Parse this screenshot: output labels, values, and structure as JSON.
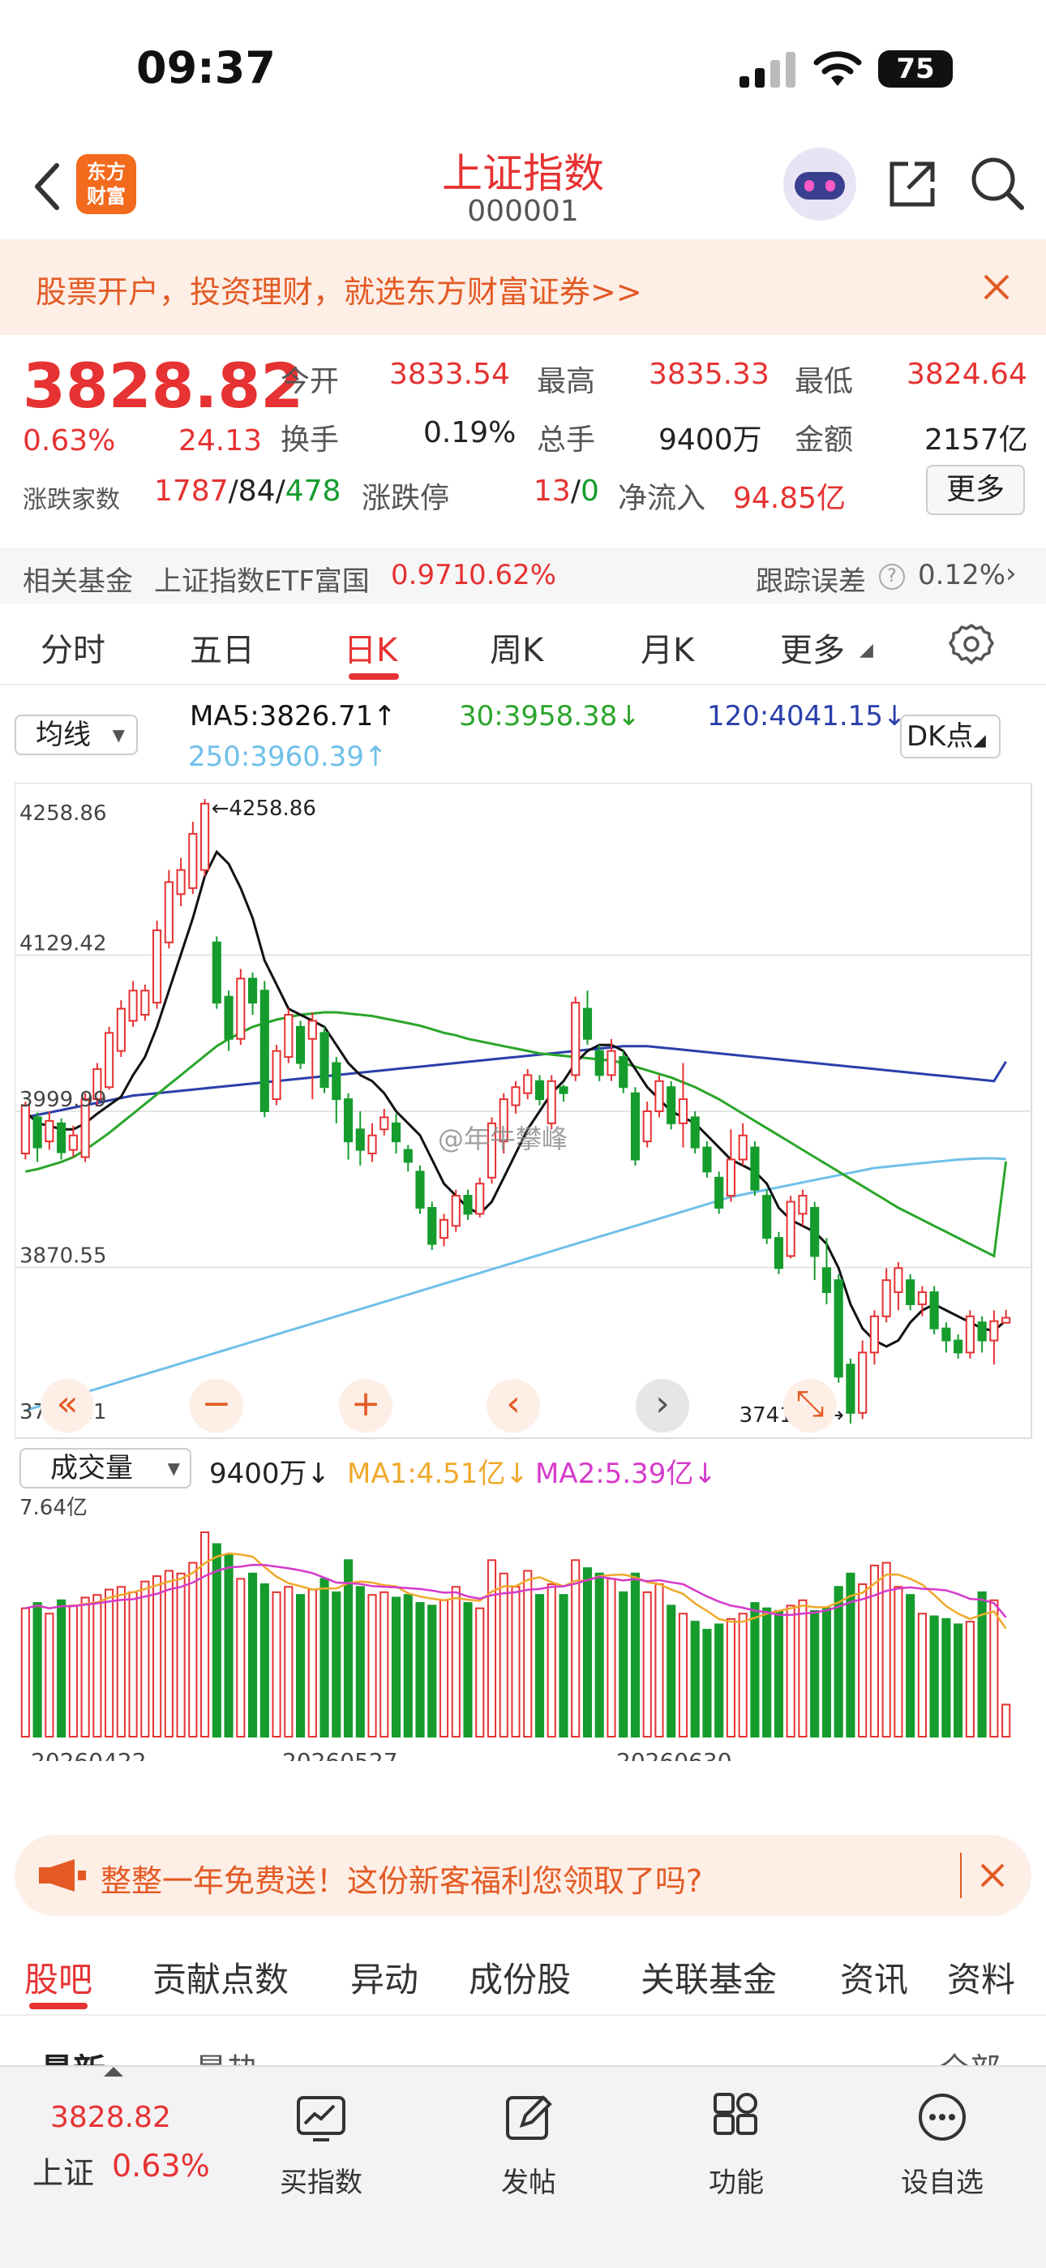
{
  "status_bar": {
    "time": "09:37",
    "battery": "75"
  },
  "nav": {
    "logo_line1": "东方",
    "logo_line2": "财富",
    "title": "上证指数",
    "code": "000001"
  },
  "banner": {
    "text": "股票开户，投资理财，就选东方财富证券>>"
  },
  "quote": {
    "price": "3828.82",
    "change_pct": "0.63%",
    "change": "24.13",
    "open_label": "今开",
    "open": "3833.54",
    "high_label": "最高",
    "high": "3835.33",
    "low_label": "最低",
    "low": "3824.64",
    "turnover_label": "换手",
    "turnover": "0.19%",
    "volume_label": "总手",
    "volume": "9400万",
    "amount_label": "金额",
    "amount": "2157亿",
    "breadth_label": "涨跌家数",
    "up_count": "1787",
    "flat_count": "84",
    "down_count": "478",
    "limit_label": "涨跌停",
    "limit_up": "13",
    "limit_down": "0",
    "netflow_label": "净流入",
    "netflow": "94.85亿",
    "more_button": "更多"
  },
  "related_fund": {
    "label": "相关基金",
    "name": "上证指数ETF富国",
    "price": "0.971",
    "pct": "0.62%",
    "tracking_label": "跟踪误差",
    "tracking": "0.12%"
  },
  "chart_tabs": [
    "分时",
    "五日",
    "日K",
    "周K",
    "月K",
    "更多"
  ],
  "active_tab": "日K",
  "chart_controls": {
    "ma_select": "均线",
    "ma5": "MA5:3826.71↑",
    "ma30": "30:3958.38↓",
    "ma120": "120:4041.15↓",
    "ma250": "250:3960.39↑",
    "dk_button": "DK点",
    "vol_select": "成交量",
    "vol_value": "9400万↓",
    "vol_ma1": "MA1:4.51亿↓",
    "vol_ma2": "MA2:5.39亿↓",
    "watermark": "@年牛攀峰"
  },
  "chart_data": {
    "type": "candlestick",
    "y_ticks": [
      "4258.86",
      "4129.42",
      "3999.99",
      "3870.55",
      "3741.11"
    ],
    "ylim": [
      3741.11,
      4258.86
    ],
    "max_label": "←4258.86",
    "min_label": "3741.11→",
    "vol_max_label": "7.64亿",
    "x_labels": [
      "20260422",
      "20260527",
      "20260630"
    ],
    "colors": {
      "up": "#e63232",
      "down": "#159c2d",
      "ma5": "#111111",
      "ma30": "#2aa52a",
      "ma120": "#2a3faa",
      "ma250": "#6fc0ea",
      "vol_ma1": "#f0a92a",
      "vol_ma2": "#d63acb"
    },
    "candles": [
      [
        3965,
        4005,
        4008,
        3960
      ],
      [
        3995,
        3970,
        3999,
        3958
      ],
      [
        3975,
        3992,
        4000,
        3968
      ],
      [
        3990,
        3966,
        3994,
        3960
      ],
      [
        3968,
        3980,
        3988,
        3962
      ],
      [
        3962,
        4010,
        4015,
        3958
      ],
      [
        4010,
        4035,
        4040,
        4005
      ],
      [
        4020,
        4065,
        4070,
        4018
      ],
      [
        4050,
        4085,
        4092,
        4045
      ],
      [
        4075,
        4100,
        4108,
        4070
      ],
      [
        4080,
        4100,
        4105,
        4075
      ],
      [
        4090,
        4150,
        4158,
        4085
      ],
      [
        4140,
        4190,
        4200,
        4135
      ],
      [
        4180,
        4200,
        4210,
        4170
      ],
      [
        4185,
        4230,
        4240,
        4180
      ],
      [
        4200,
        4255,
        4258.86,
        4195
      ],
      [
        4140,
        4090,
        4145,
        4085
      ],
      [
        4095,
        4060,
        4100,
        4050
      ],
      [
        4060,
        4110,
        4118,
        4055
      ],
      [
        4110,
        4090,
        4115,
        4080
      ],
      [
        4100,
        4000,
        4108,
        3995
      ],
      [
        4010,
        4050,
        4055,
        4005
      ],
      [
        4045,
        4080,
        4085,
        4040
      ],
      [
        4070,
        4040,
        4075,
        4035
      ],
      [
        4060,
        4075,
        4082,
        4010
      ],
      [
        4065,
        4020,
        4070,
        4015
      ],
      [
        4040,
        4010,
        4045,
        3990
      ],
      [
        4010,
        3975,
        4015,
        3960
      ],
      [
        3985,
        3968,
        4000,
        3955
      ],
      [
        3965,
        3980,
        3990,
        3958
      ],
      [
        3985,
        3995,
        4002,
        3980
      ],
      [
        3990,
        3975,
        3998,
        3965
      ],
      [
        3968,
        3958,
        3972,
        3950
      ],
      [
        3950,
        3920,
        3955,
        3915
      ],
      [
        3920,
        3890,
        3925,
        3885
      ],
      [
        3895,
        3910,
        3915,
        3888
      ],
      [
        3905,
        3930,
        3935,
        3900
      ],
      [
        3930,
        3915,
        3935,
        3910
      ],
      [
        3915,
        3940,
        3945,
        3912
      ],
      [
        3945,
        3990,
        3995,
        3940
      ],
      [
        3975,
        4010,
        4015,
        3965
      ],
      [
        4005,
        4020,
        4025,
        3998
      ],
      [
        4015,
        4030,
        4035,
        4010
      ],
      [
        4025,
        4010,
        4030,
        4005
      ],
      [
        3990,
        4025,
        4030,
        3985
      ],
      [
        4020,
        4015,
        4022,
        4008
      ],
      [
        4030,
        4090,
        4095,
        4025
      ],
      [
        4085,
        4060,
        4100,
        4055
      ],
      [
        4050,
        4030,
        4055,
        4025
      ],
      [
        4030,
        4050,
        4060,
        4025
      ],
      [
        4045,
        4020,
        4050,
        4015
      ],
      [
        4015,
        3960,
        4020,
        3955
      ],
      [
        3975,
        4000,
        4008,
        3970
      ],
      [
        4000,
        4025,
        4030,
        3995
      ],
      [
        4020,
        3990,
        4025,
        3985
      ],
      [
        3990,
        4010,
        4040,
        3970
      ],
      [
        3995,
        3970,
        4000,
        3965
      ],
      [
        3970,
        3950,
        3975,
        3945
      ],
      [
        3945,
        3920,
        3950,
        3915
      ],
      [
        3930,
        3960,
        3985,
        3925
      ],
      [
        3960,
        3980,
        3990,
        3955
      ],
      [
        3970,
        3935,
        3975,
        3930
      ],
      [
        3930,
        3895,
        3935,
        3890
      ],
      [
        3895,
        3870,
        3900,
        3865
      ],
      [
        3880,
        3925,
        3930,
        3878
      ],
      [
        3915,
        3930,
        3935,
        3905
      ],
      [
        3920,
        3880,
        3925,
        3860
      ],
      [
        3870,
        3850,
        3895,
        3840
      ],
      [
        3860,
        3780,
        3865,
        3775
      ],
      [
        3790,
        3750,
        3795,
        3741.11
      ],
      [
        3750,
        3800,
        3810,
        3745
      ],
      [
        3800,
        3830,
        3835,
        3790
      ],
      [
        3830,
        3860,
        3870,
        3825
      ],
      [
        3850,
        3870,
        3875,
        3835
      ],
      [
        3860,
        3840,
        3865,
        3835
      ],
      [
        3840,
        3850,
        3855,
        3830
      ],
      [
        3850,
        3820,
        3855,
        3815
      ],
      [
        3820,
        3810,
        3825,
        3800
      ],
      [
        3810,
        3800,
        3815,
        3795
      ],
      [
        3800,
        3830,
        3835,
        3795
      ],
      [
        3825,
        3810,
        3830,
        3800
      ],
      [
        3810,
        3826,
        3835,
        3790
      ],
      [
        3824.64,
        3828.82,
        3835.33,
        3824.64
      ]
    ],
    "volumes": [
      4.8,
      5.0,
      4.6,
      5.1,
      4.9,
      5.2,
      5.3,
      5.5,
      5.6,
      5.4,
      5.8,
      6.0,
      6.2,
      6.1,
      6.5,
      7.64,
      7.2,
      6.8,
      5.9,
      6.1,
      5.7,
      5.4,
      5.6,
      5.3,
      5.5,
      5.9,
      5.4,
      6.6,
      5.6,
      5.3,
      5.4,
      5.2,
      5.3,
      5.0,
      4.9,
      5.1,
      5.6,
      5.0,
      4.8,
      6.6,
      6.1,
      5.6,
      6.2,
      5.3,
      5.7,
      5.3,
      6.6,
      6.3,
      6.1,
      5.9,
      5.4,
      6.1,
      5.4,
      5.7,
      4.9,
      4.6,
      4.3,
      4.0,
      4.2,
      4.4,
      4.6,
      5.0,
      4.8,
      4.7,
      4.9,
      5.1,
      4.7,
      4.8,
      5.6,
      6.1,
      5.7,
      6.4,
      6.5,
      5.6,
      5.3,
      4.6,
      4.5,
      4.4,
      4.2,
      4.3,
      5.4,
      5.1,
      1.2
    ],
    "ma5": [
      4000,
      3990,
      3988,
      3985,
      3985,
      3990,
      3998,
      4005,
      4012,
      4030,
      4045,
      4070,
      4100,
      4130,
      4160,
      4195,
      4215,
      4205,
      4185,
      4160,
      4125,
      4105,
      4085,
      4080,
      4075,
      4070,
      4055,
      4040,
      4030,
      4025,
      4015,
      4000,
      3990,
      3980,
      3960,
      3940,
      3930,
      3920,
      3915,
      3925,
      3945,
      3965,
      3985,
      4000,
      4015,
      4025,
      4040,
      4050,
      4055,
      4055,
      4050,
      4035,
      4020,
      4010,
      4000,
      3995,
      3990,
      3980,
      3970,
      3960,
      3955,
      3950,
      3940,
      3920,
      3910,
      3905,
      3900,
      3890,
      3870,
      3840,
      3820,
      3810,
      3805,
      3810,
      3825,
      3835,
      3840,
      3835,
      3830,
      3825,
      3820,
      3818,
      3826.71
    ],
    "ma30": [
      3950,
      3952,
      3955,
      3958,
      3962,
      3968,
      3975,
      3982,
      3990,
      3998,
      4006,
      4014,
      4022,
      4030,
      4038,
      4046,
      4054,
      4060,
      4065,
      4070,
      4073,
      4076,
      4078,
      4080,
      4081,
      4082,
      4082,
      4081,
      4080,
      4079,
      4077,
      4075,
      4073,
      4071,
      4068,
      4065,
      4063,
      4060,
      4058,
      4056,
      4054,
      4052,
      4050,
      4048,
      4047,
      4046,
      4045,
      4044,
      4043,
      4042,
      4040,
      4037,
      4034,
      4031,
      4028,
      4024,
      4020,
      4015,
      4010,
      4004,
      3998,
      3992,
      3986,
      3980,
      3974,
      3968,
      3962,
      3956,
      3950,
      3944,
      3938,
      3932,
      3926,
      3920,
      3915,
      3910,
      3905,
      3900,
      3895,
      3890,
      3885,
      3880,
      3958.38
    ],
    "ma120": [
      3995,
      3997,
      3999,
      4001,
      4003,
      4005,
      4007,
      4009,
      4011,
      4013,
      4014,
      4015,
      4016,
      4017,
      4018,
      4019,
      4020,
      4021,
      4022,
      4023,
      4024,
      4025,
      4026,
      4027,
      4028,
      4029,
      4030,
      4031,
      4032,
      4033,
      4034,
      4035,
      4036,
      4037,
      4038,
      4039,
      4040,
      4041,
      4042,
      4043,
      4044,
      4045,
      4046,
      4047,
      4048,
      4049,
      4050,
      4051,
      4052,
      4053,
      4054,
      4054,
      4054,
      4053,
      4052,
      4051,
      4050,
      4049,
      4048,
      4047,
      4046,
      4045,
      4044,
      4043,
      4042,
      4041,
      4040,
      4039,
      4038,
      4037,
      4036,
      4035,
      4034,
      4033,
      4032,
      4031,
      4030,
      4029,
      4028,
      4027,
      4026,
      4025,
      4041.15
    ],
    "ma250": [
      3752,
      3755,
      3758,
      3761,
      3764,
      3767,
      3770,
      3773,
      3776,
      3779,
      3782,
      3785,
      3788,
      3791,
      3794,
      3797,
      3800,
      3803,
      3806,
      3809,
      3812,
      3815,
      3818,
      3821,
      3824,
      3827,
      3830,
      3833,
      3836,
      3839,
      3842,
      3845,
      3848,
      3851,
      3854,
      3857,
      3860,
      3863,
      3866,
      3869,
      3872,
      3875,
      3878,
      3881,
      3884,
      3887,
      3890,
      3893,
      3896,
      3899,
      3902,
      3905,
      3908,
      3911,
      3914,
      3917,
      3920,
      3923,
      3926,
      3929,
      3931,
      3933,
      3935,
      3937,
      3939,
      3941,
      3943,
      3945,
      3947,
      3949,
      3951,
      3953,
      3954,
      3955,
      3956,
      3957,
      3958,
      3959,
      3960,
      3960.5,
      3961,
      3961,
      3960.39
    ]
  },
  "chart_nav_buttons": [
    "«",
    "−",
    "+",
    "‹",
    "›",
    "⤡"
  ],
  "promo": {
    "text": "整整一年免费送！这份新客福利您领取了吗?"
  },
  "bottom_tabs": [
    "股吧",
    "贡献点数",
    "异动",
    "成份股",
    "关联基金",
    "资讯",
    "资料"
  ],
  "sub_tabs": [
    "最新",
    "最热",
    "全部"
  ],
  "footer": {
    "price": "3828.82",
    "name": "上证",
    "pct": "0.63%",
    "items": [
      "买指数",
      "发帖",
      "功能",
      "设自选"
    ]
  }
}
